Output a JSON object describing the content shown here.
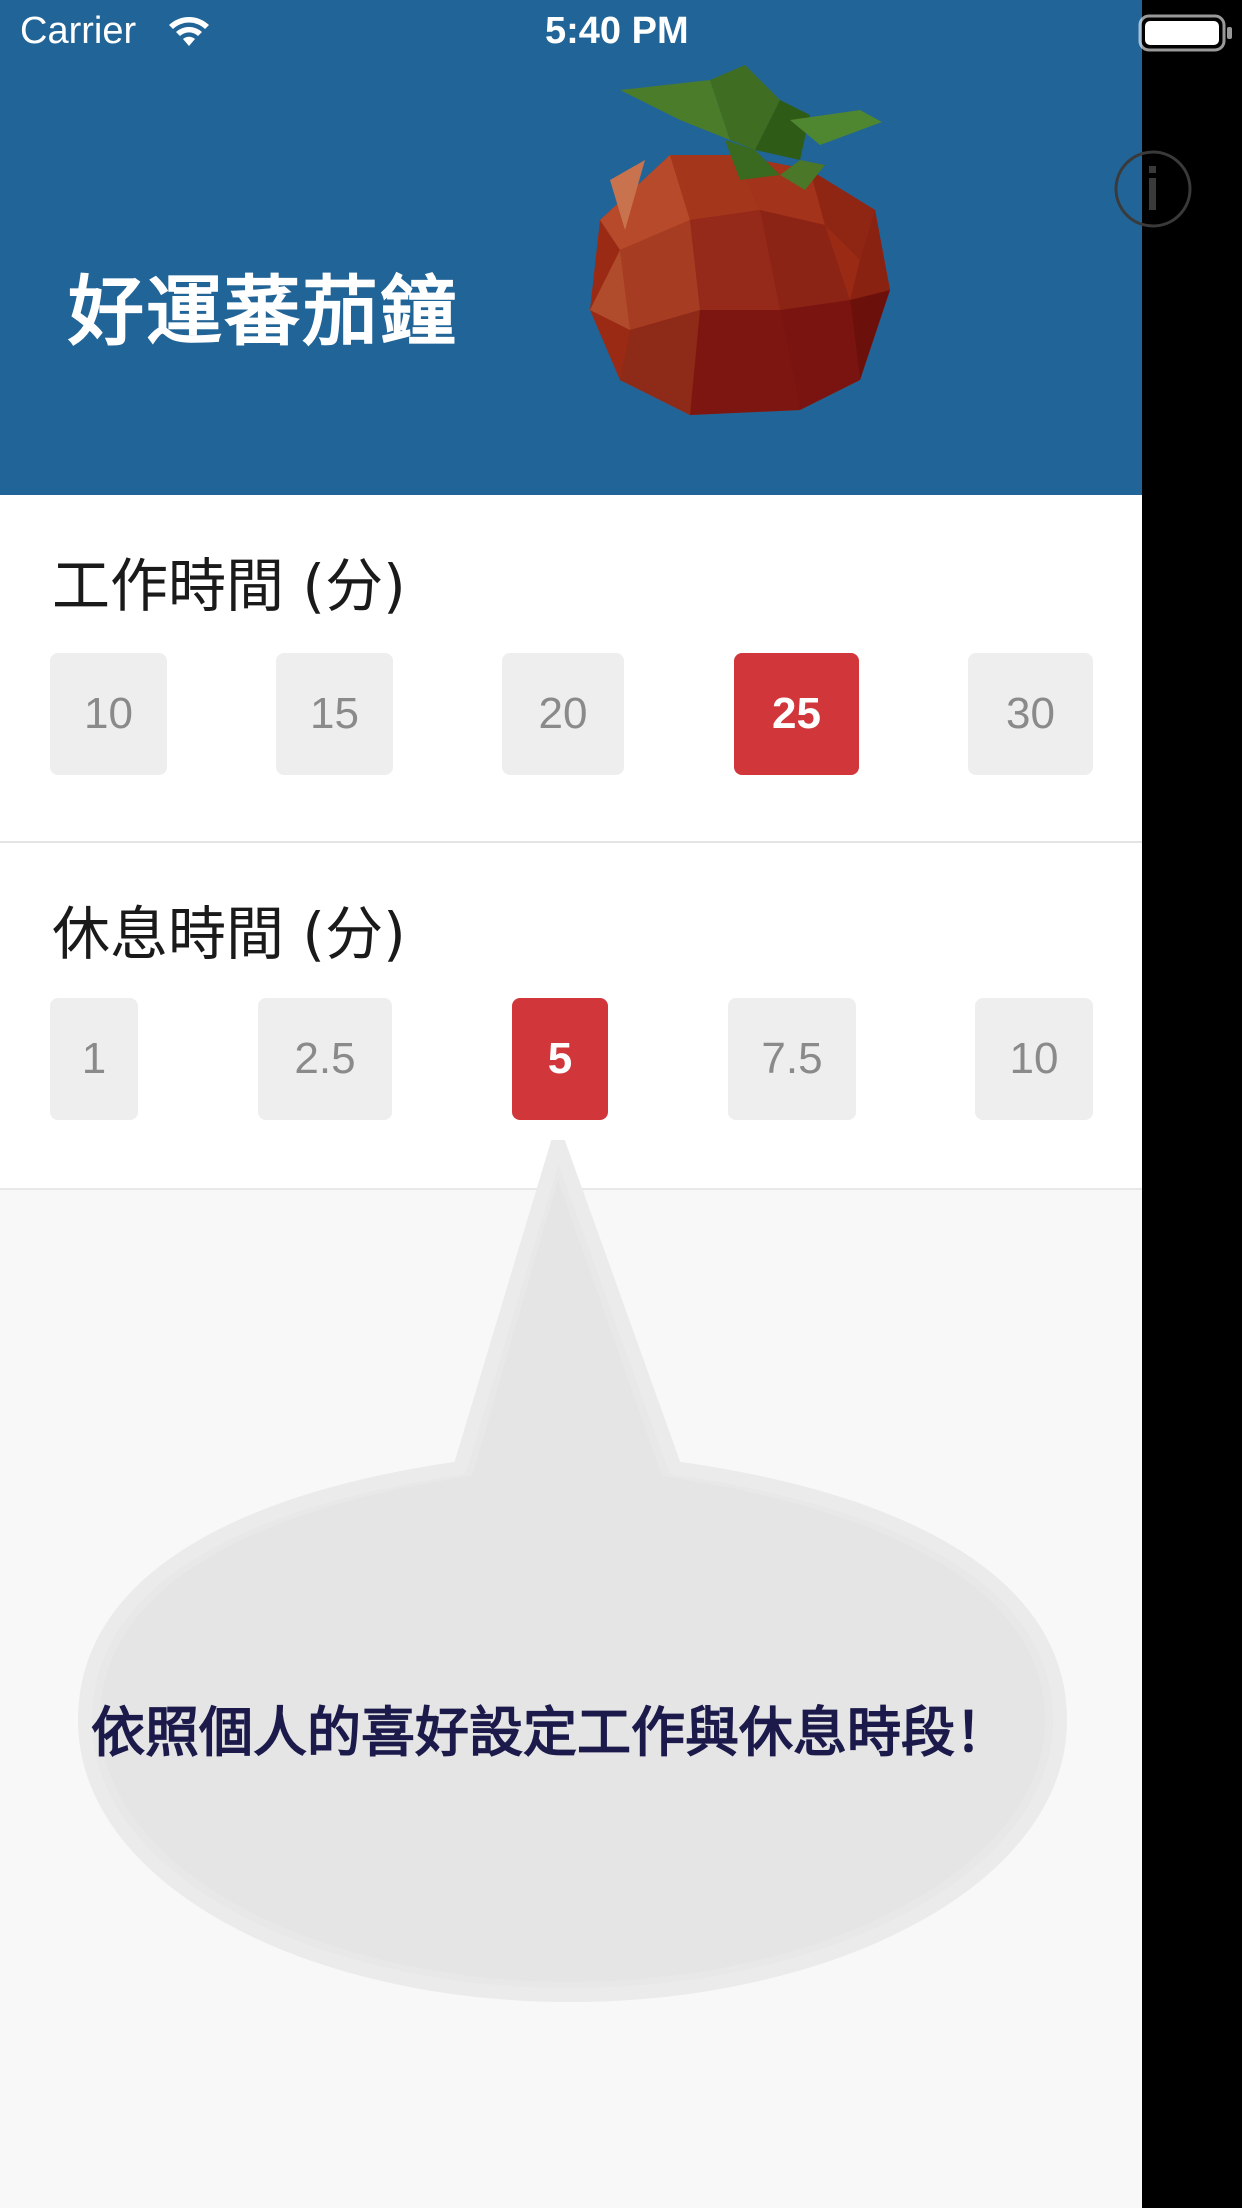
{
  "status_bar": {
    "carrier": "Carrier",
    "time": "5:40 PM",
    "wifi_icon": "wifi-icon",
    "battery_icon": "battery-icon"
  },
  "header": {
    "title": "好運蕃茄鐘",
    "background_color": "#216497",
    "logo_icon": "tomato-icon",
    "info_icon": "info-icon"
  },
  "work_time": {
    "title": "工作時間 (分)",
    "options": [
      {
        "label": "10"
      },
      {
        "label": "15"
      },
      {
        "label": "20"
      },
      {
        "label": "25",
        "selected": true
      },
      {
        "label": "30"
      }
    ]
  },
  "rest_time": {
    "title": "休息時間 (分)",
    "options": [
      {
        "label": "1"
      },
      {
        "label": "2.5"
      },
      {
        "label": "5",
        "selected": true
      },
      {
        "label": "7.5"
      },
      {
        "label": "10"
      }
    ]
  },
  "tooltip": {
    "text": "依照個人的喜好設定工作與休息時段！"
  },
  "colors": {
    "accent": "#d1363a",
    "option_bg": "#eeeeee",
    "option_text": "#8a8a8a",
    "tooltip_text": "#1b1a4a"
  }
}
